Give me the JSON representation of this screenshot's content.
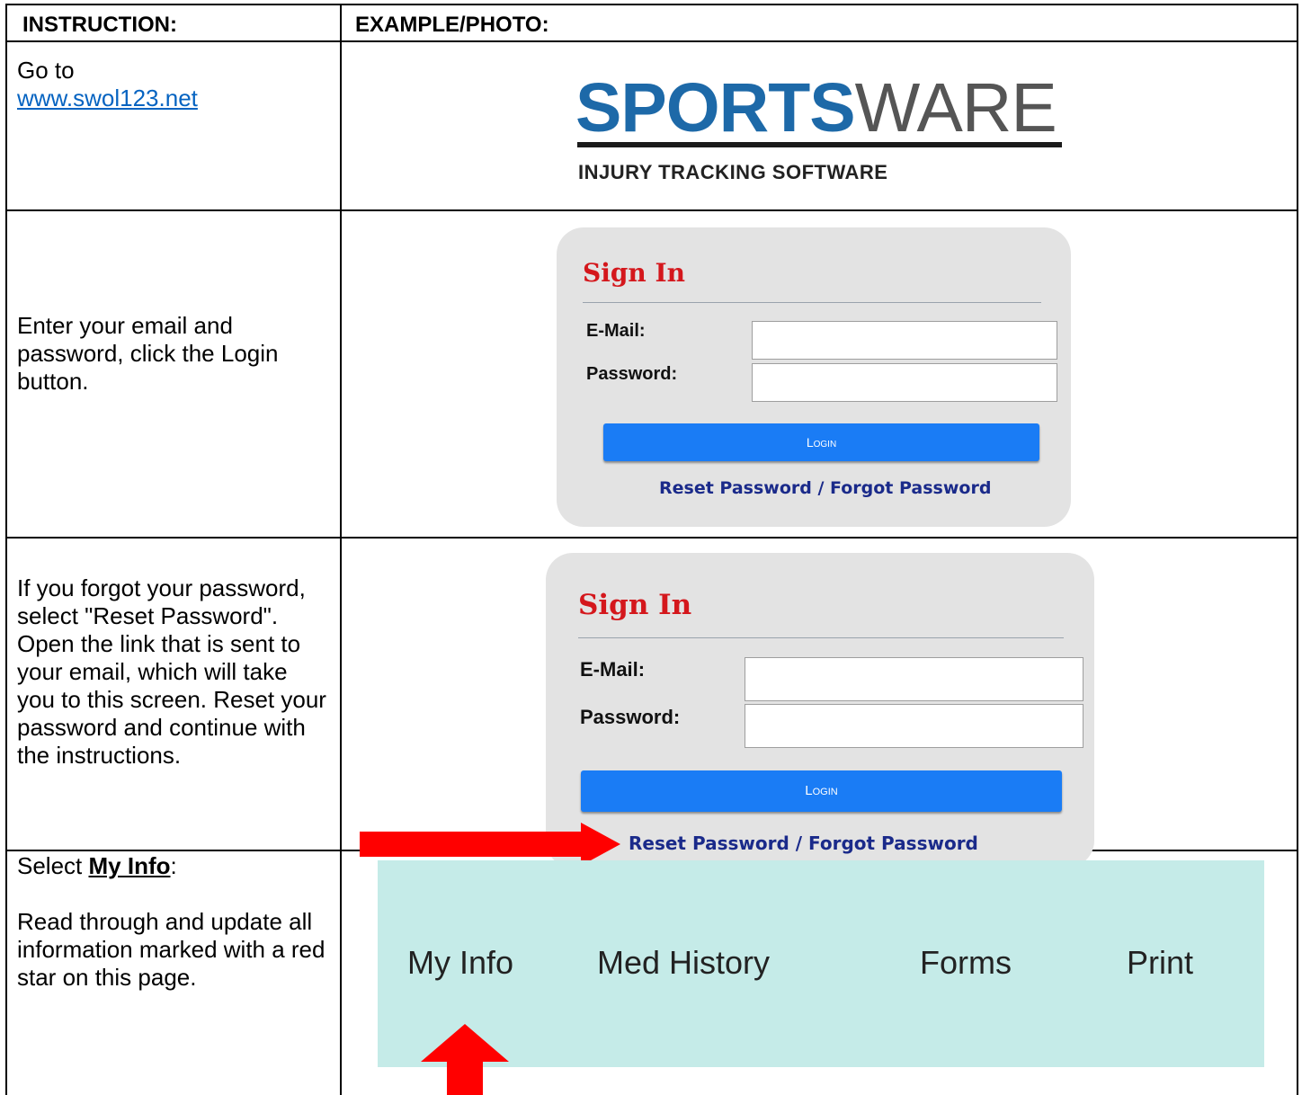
{
  "headers": {
    "instruction": "INSTRUCTION:",
    "example": "EXAMPLE/PHOTO:"
  },
  "rows": [
    {
      "text_prefix": "Go to",
      "link": "www.swol123.net"
    },
    {
      "text": "Enter your email  and password, click the Login button."
    },
    {
      "text": "If you forgot your password, select \"Reset Password\". Open the link that is sent to your email, which will take you to this screen. Reset your password and continue with the instructions."
    },
    {
      "prefix": "Select ",
      "bold": "My Info",
      "suffix": ":",
      "text2": "Read through and update all information marked with a red star on this page."
    }
  ],
  "logo": {
    "sports": "SPORTS",
    "ware": "WARE",
    "tagline": "INJURY TRACKING SOFTWARE"
  },
  "signin": {
    "title": "Sign In",
    "email_label": "E-Mail:",
    "password_label": "Password:",
    "login": "Login",
    "reset_link": "Reset Password / Forgot Password"
  },
  "nav": {
    "items": [
      "My Info",
      "Med History",
      "Forms",
      "Print"
    ]
  },
  "colors": {
    "arrow": "#ff0000",
    "nav_bg": "#c5ebe8",
    "login_btn": "#1a7cf5",
    "title_red": "#d4171c"
  }
}
